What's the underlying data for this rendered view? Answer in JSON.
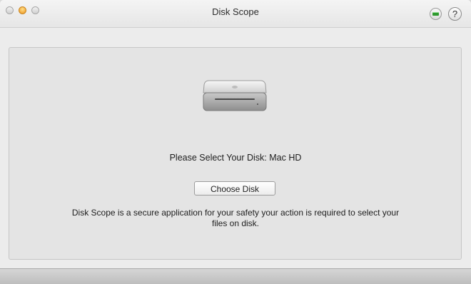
{
  "window": {
    "title": "Disk Scope",
    "help_label": "?"
  },
  "icons": {
    "battery": "battery-icon",
    "help": "help-icon",
    "device": "mac-mini-icon"
  },
  "main": {
    "prompt": "Please Select Your Disk: Mac HD",
    "choose_button_label": "Choose Disk",
    "description": "Disk Scope is a secure application for your safety your action is required to select your files on disk."
  }
}
